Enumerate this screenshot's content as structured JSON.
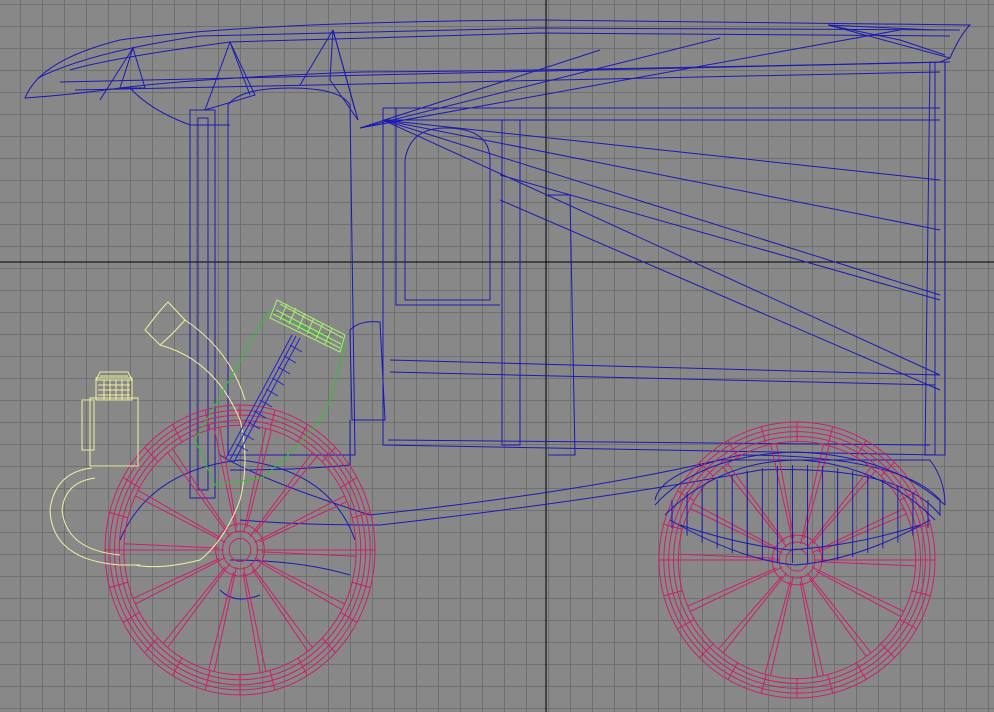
{
  "viewport": {
    "view": "side",
    "grid": true,
    "colors": {
      "background": "#888888",
      "grid": "#6e6e6e",
      "axis": "#000000",
      "body_wire": "#1a1ab4",
      "wheel_wire": "#cc1f6a",
      "engine_wire": "#f0f0a0",
      "steering_column": "#2323c8",
      "steering_frame": "#2fc22f",
      "steering_wheel": "#a8f070"
    },
    "objects": [
      {
        "name": "body",
        "icon": "cube-icon"
      },
      {
        "name": "front-wheel",
        "icon": "wheel-icon"
      },
      {
        "name": "rear-wheel",
        "icon": "wheel-icon"
      },
      {
        "name": "engine",
        "icon": "engine-icon"
      },
      {
        "name": "steering",
        "icon": "steering-icon"
      }
    ]
  }
}
